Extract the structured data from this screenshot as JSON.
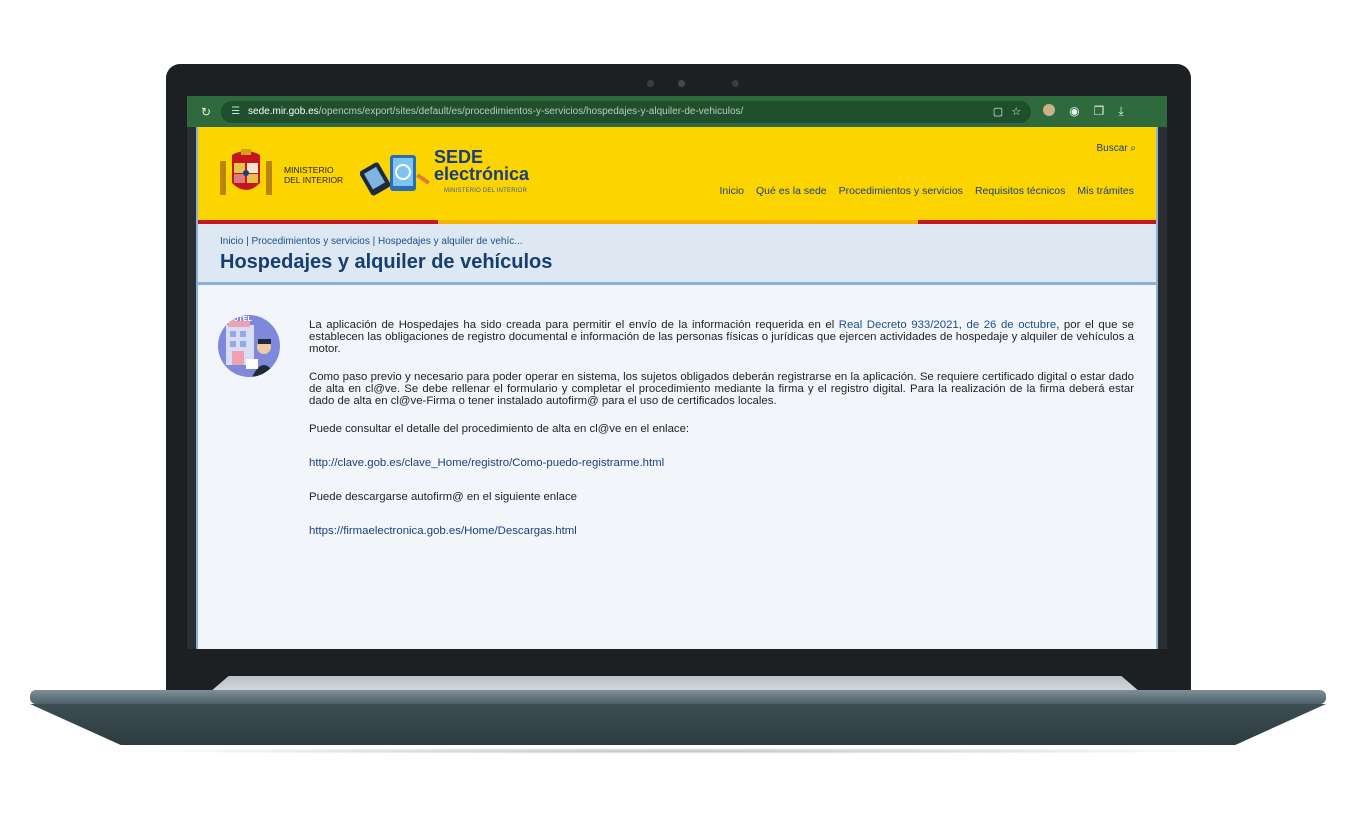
{
  "browser": {
    "reload_icon": "reload-icon",
    "url_host": "sede.mir.gob.es",
    "url_path": "/opencms/export/sites/default/es/procedimientos-y-servicios/hospedajes-y-alquiler-de-vehiculos/"
  },
  "header": {
    "ministerio_line1": "MINISTERIO",
    "ministerio_line2": "DEL INTERIOR",
    "sede_title": "SEDE",
    "sede_subtitle": "electrónica",
    "sede_ministry": "MINISTERIO DEL INTERIOR",
    "search_label": "Buscar",
    "nav": [
      "Inicio",
      "Qué es la sede",
      "Procedimientos y servicios",
      "Requisitos técnicos",
      "Mis trámites"
    ],
    "colors": {
      "yellow": "#fcd500",
      "red": "#c4161c",
      "blue": "#1b3e7a"
    }
  },
  "title_band": {
    "breadcrumb": "Inicio | Procedimientos y servicios | Hospedajes y alquiler de vehíc...",
    "title": "Hospedajes y alquiler de vehículos"
  },
  "content": {
    "p1_before": "La aplicación de Hospedajes ha sido creada para permitir el envío de la información requerida en el ",
    "p1_link": "Real Decreto 933/2021, de 26 de octubre",
    "p1_after": ", por el que se establecen las obligaciones de registro documental e información de las personas físicas o jurídicas que ejercen actividades de hospedaje y alquiler de vehículos a motor.",
    "p2": "Como paso previo y necesario para poder operar en sistema, los sujetos obligados deberán registrarse en la aplicación. Se requiere certificado digital o estar dado de alta en cl@ve. Se debe rellenar el formulario y completar el procedimiento mediante la firma y el registro digital. Para la realización de la firma deberá estar dado de alta en cl@ve-Firma o tener instalado autofirm@ para el uso de certificados locales.",
    "p3": "Puede consultar el detalle del procedimiento de alta en cl@ve en el enlace:",
    "link_clave": "http://clave.gob.es/clave_Home/registro/Como-puedo-registrarme.html",
    "p4": "Puede descargarse autofirm@ en el siguiente enlace",
    "link_firma": "https://firmaelectronica.gob.es/Home/Descargas.html",
    "illustration_label": "HOTEL"
  }
}
